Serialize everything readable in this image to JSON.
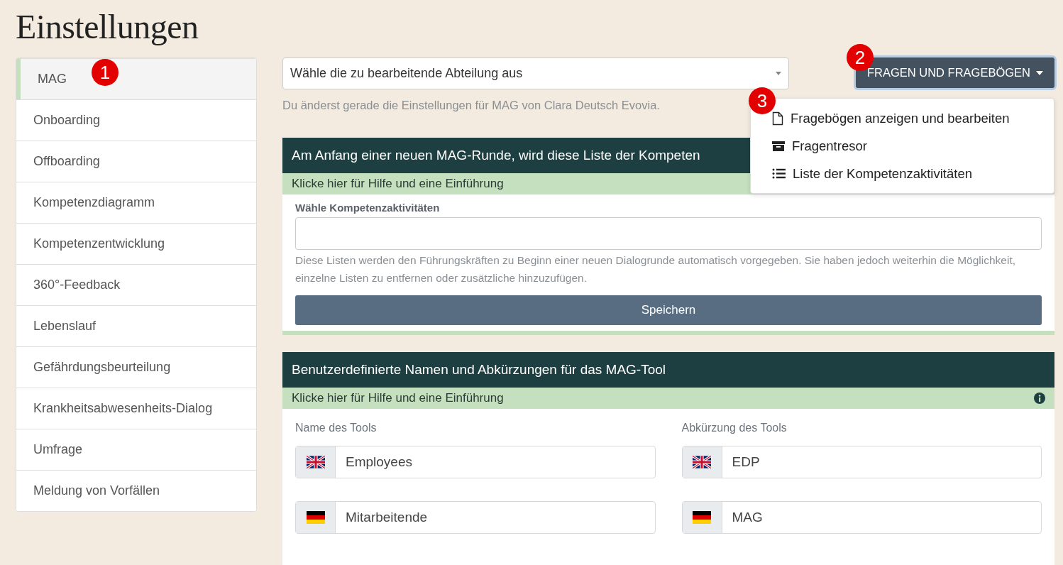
{
  "page": {
    "title": "Einstellungen"
  },
  "sidebar": {
    "items": [
      {
        "label": "MAG",
        "selected": true
      },
      {
        "label": "Onboarding",
        "selected": false
      },
      {
        "label": "Offboarding",
        "selected": false
      },
      {
        "label": "Kompetenzdiagramm",
        "selected": false
      },
      {
        "label": "Kompetenzentwicklung",
        "selected": false
      },
      {
        "label": "360°-Feedback",
        "selected": false
      },
      {
        "label": "Lebenslauf",
        "selected": false
      },
      {
        "label": "Gefährdungsbeurteilung",
        "selected": false
      },
      {
        "label": "Krankheitsabwesenheits-Dialog",
        "selected": false
      },
      {
        "label": "Umfrage",
        "selected": false
      },
      {
        "label": "Meldung von Vorfällen",
        "selected": false
      }
    ]
  },
  "department_select": {
    "placeholder": "Wähle die zu bearbeitende Abteilung aus",
    "hint": "Du änderst gerade die Einstellungen für MAG von Clara Deutsch Evovia."
  },
  "menu_button": {
    "label": "FRAGEN UND FRAGEBÖGEN",
    "expanded": true
  },
  "menu": {
    "items": [
      {
        "kind": "document",
        "label": "Fragebögen anzeigen und bearbeiten"
      },
      {
        "kind": "archive",
        "label": "Fragentresor"
      },
      {
        "kind": "list",
        "label": "Liste der Kompetenzaktivitäten"
      }
    ]
  },
  "annotations": [
    {
      "kind": "sidebar",
      "label": "1"
    },
    {
      "kind": "button",
      "label": "2"
    },
    {
      "kind": "menu",
      "label": "3"
    }
  ],
  "cards": [
    {
      "kind": "activities",
      "title": "Am Anfang einer neuen MAG-Runde, wird diese Liste der Kompeten",
      "help": "Klicke hier für Hilfe und eine Einführung",
      "field_label": "Wähle Kompetenzaktivitäten",
      "field_hint": "Diese Listen werden den Führungskräften zu Beginn einer neuen Dialogrunde automatisch vorgegeben. Sie haben jedoch weiterhin die Möglichkeit, einzelne Listen zu entfernen oder zusätzliche hinzuzufügen.",
      "button": "Speichern"
    },
    {
      "kind": "names",
      "title": "Benutzerdefinierte Namen und Abkürzungen für das MAG-Tool",
      "help": "Klicke hier für Hilfe und eine Einführung",
      "columns": [
        {
          "label": "Name des Tools",
          "fields": [
            {
              "kind": "uk",
              "value": "Employees"
            },
            {
              "kind": "de",
              "value": "Mitarbeitende"
            }
          ]
        },
        {
          "label": "Abkürzung des Tools",
          "fields": [
            {
              "kind": "uk",
              "value": "EDP"
            },
            {
              "kind": "de",
              "value": "MAG"
            }
          ]
        }
      ]
    }
  ]
}
